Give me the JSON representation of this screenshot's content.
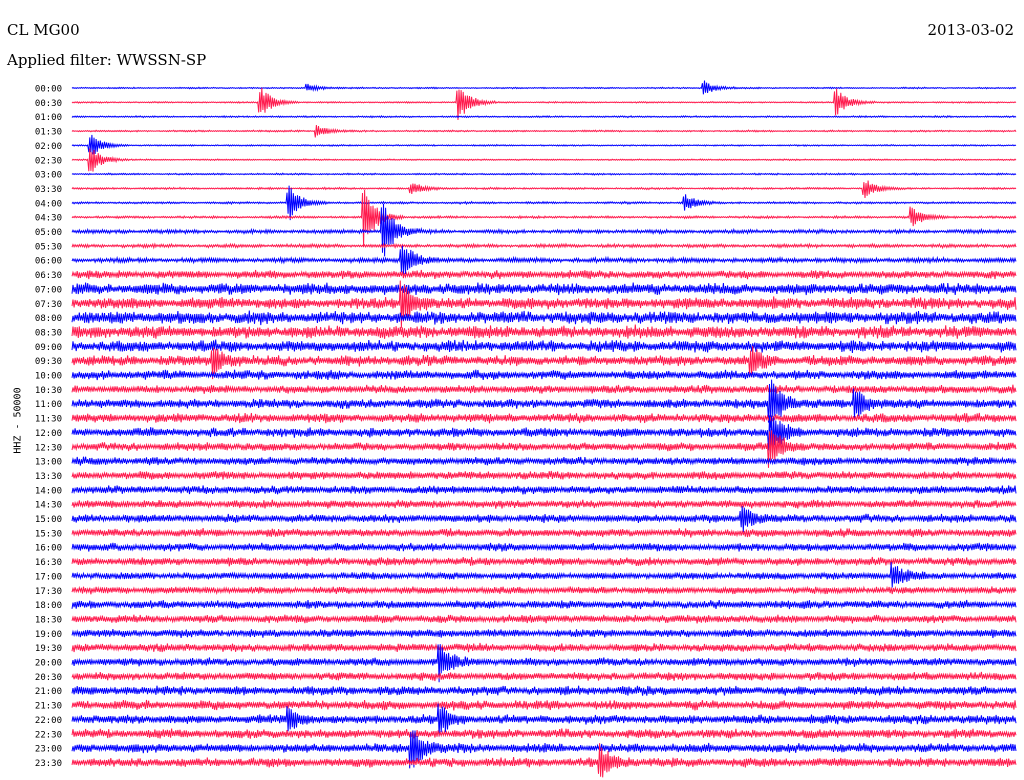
{
  "header": {
    "station": "CL MG00",
    "date": "2013-03-02",
    "filter": "Applied filter: WWSSN-SP"
  },
  "chart_data": {
    "type": "line",
    "title": "",
    "ylabel": "HHZ - 50000",
    "xlabel": "",
    "colors": {
      "even_row": "#0000ff",
      "odd_row": "#ff1a4d"
    },
    "grid": false,
    "row_labels": [
      "00:00",
      "00:30",
      "01:00",
      "01:30",
      "02:00",
      "02:30",
      "03:00",
      "03:30",
      "04:00",
      "04:30",
      "05:00",
      "05:30",
      "06:00",
      "06:30",
      "07:00",
      "07:30",
      "08:00",
      "08:30",
      "09:00",
      "09:30",
      "10:00",
      "10:30",
      "11:00",
      "11:30",
      "12:00",
      "12:30",
      "13:00",
      "13:30",
      "14:00",
      "14:30",
      "15:00",
      "15:30",
      "16:00",
      "16:30",
      "17:00",
      "17:30",
      "18:00",
      "18:30",
      "19:00",
      "19:30",
      "20:00",
      "20:30",
      "21:00",
      "21:30",
      "22:00",
      "22:30",
      "23:00",
      "23:30"
    ],
    "noise_level": [
      0.6,
      0.6,
      0.7,
      0.7,
      0.6,
      0.6,
      0.7,
      0.8,
      0.9,
      1.0,
      1.6,
      1.5,
      2.0,
      3.5,
      5,
      5,
      5.5,
      5.5,
      5,
      4.5,
      4,
      3.5,
      4,
      4,
      4,
      3.5,
      3.5,
      3.5,
      3.5,
      3.5,
      3.5,
      3.5,
      3.5,
      3.5,
      3,
      3,
      3.5,
      3.5,
      3.5,
      3.5,
      3.5,
      3.5,
      4,
      4,
      4,
      4,
      4,
      4
    ],
    "events": [
      {
        "row": 0,
        "t": 0.67,
        "amp": 7
      },
      {
        "row": 0,
        "t": 0.25,
        "amp": 4
      },
      {
        "row": 1,
        "t": 0.2,
        "amp": 16
      },
      {
        "row": 1,
        "t": 0.41,
        "amp": 18
      },
      {
        "row": 1,
        "t": 0.81,
        "amp": 14
      },
      {
        "row": 3,
        "t": 0.26,
        "amp": 6
      },
      {
        "row": 4,
        "t": 0.02,
        "amp": 12
      },
      {
        "row": 5,
        "t": 0.02,
        "amp": 14
      },
      {
        "row": 7,
        "t": 0.84,
        "amp": 10
      },
      {
        "row": 7,
        "t": 0.36,
        "amp": 6
      },
      {
        "row": 8,
        "t": 0.23,
        "amp": 18
      },
      {
        "row": 8,
        "t": 0.65,
        "amp": 8
      },
      {
        "row": 9,
        "t": 0.31,
        "amp": 30
      },
      {
        "row": 9,
        "t": 0.89,
        "amp": 10
      },
      {
        "row": 10,
        "t": 0.33,
        "amp": 30
      },
      {
        "row": 12,
        "t": 0.35,
        "amp": 20
      },
      {
        "row": 15,
        "t": 0.35,
        "amp": 22
      },
      {
        "row": 19,
        "t": 0.15,
        "amp": 14
      },
      {
        "row": 19,
        "t": 0.72,
        "amp": 12
      },
      {
        "row": 22,
        "t": 0.74,
        "amp": 28
      },
      {
        "row": 22,
        "t": 0.83,
        "amp": 14
      },
      {
        "row": 24,
        "t": 0.74,
        "amp": 22
      },
      {
        "row": 25,
        "t": 0.74,
        "amp": 22
      },
      {
        "row": 30,
        "t": 0.71,
        "amp": 12
      },
      {
        "row": 34,
        "t": 0.87,
        "amp": 12
      },
      {
        "row": 40,
        "t": 0.39,
        "amp": 18
      },
      {
        "row": 44,
        "t": 0.39,
        "amp": 14
      },
      {
        "row": 44,
        "t": 0.23,
        "amp": 10
      },
      {
        "row": 46,
        "t": 0.36,
        "amp": 22
      },
      {
        "row": 47,
        "t": 0.56,
        "amp": 16
      }
    ]
  }
}
